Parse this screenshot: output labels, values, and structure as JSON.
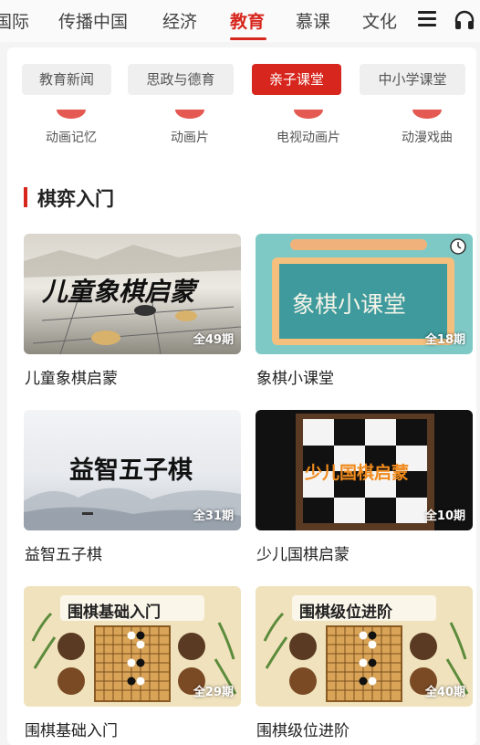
{
  "nav": {
    "items": [
      "国际",
      "传播中国",
      "经济",
      "教育",
      "慕课",
      "文化"
    ],
    "active_index": 3
  },
  "subtabs": [
    "教育新闻",
    "思政与德育",
    "亲子课堂",
    "中小学课堂"
  ],
  "categories": [
    "动画记忆",
    "动画片",
    "电视动画片",
    "动漫戏曲"
  ],
  "section": {
    "title": "棋弈入门"
  },
  "courses": [
    {
      "title": "儿童象棋启蒙",
      "count": "全49期",
      "thumb_text": "儿童象棋启蒙"
    },
    {
      "title": "象棋小课堂",
      "count": "全18期",
      "thumb_text": "象棋小课堂"
    },
    {
      "title": "益智五子棋",
      "count": "全31期",
      "thumb_text": "益智五子棋"
    },
    {
      "title": "少儿国棋启蒙",
      "count": "全10期",
      "thumb_text": "少儿国棋启蒙"
    },
    {
      "title": "围棋基础入门",
      "count": "全29期",
      "thumb_text": "围棋基础入门"
    },
    {
      "title": "围棋级位进阶",
      "count": "全40期",
      "thumb_text": "围棋级位进阶"
    }
  ],
  "colors": {
    "accent": "#d7261d"
  },
  "icons": [
    "menu-icon",
    "headphones-icon"
  ]
}
